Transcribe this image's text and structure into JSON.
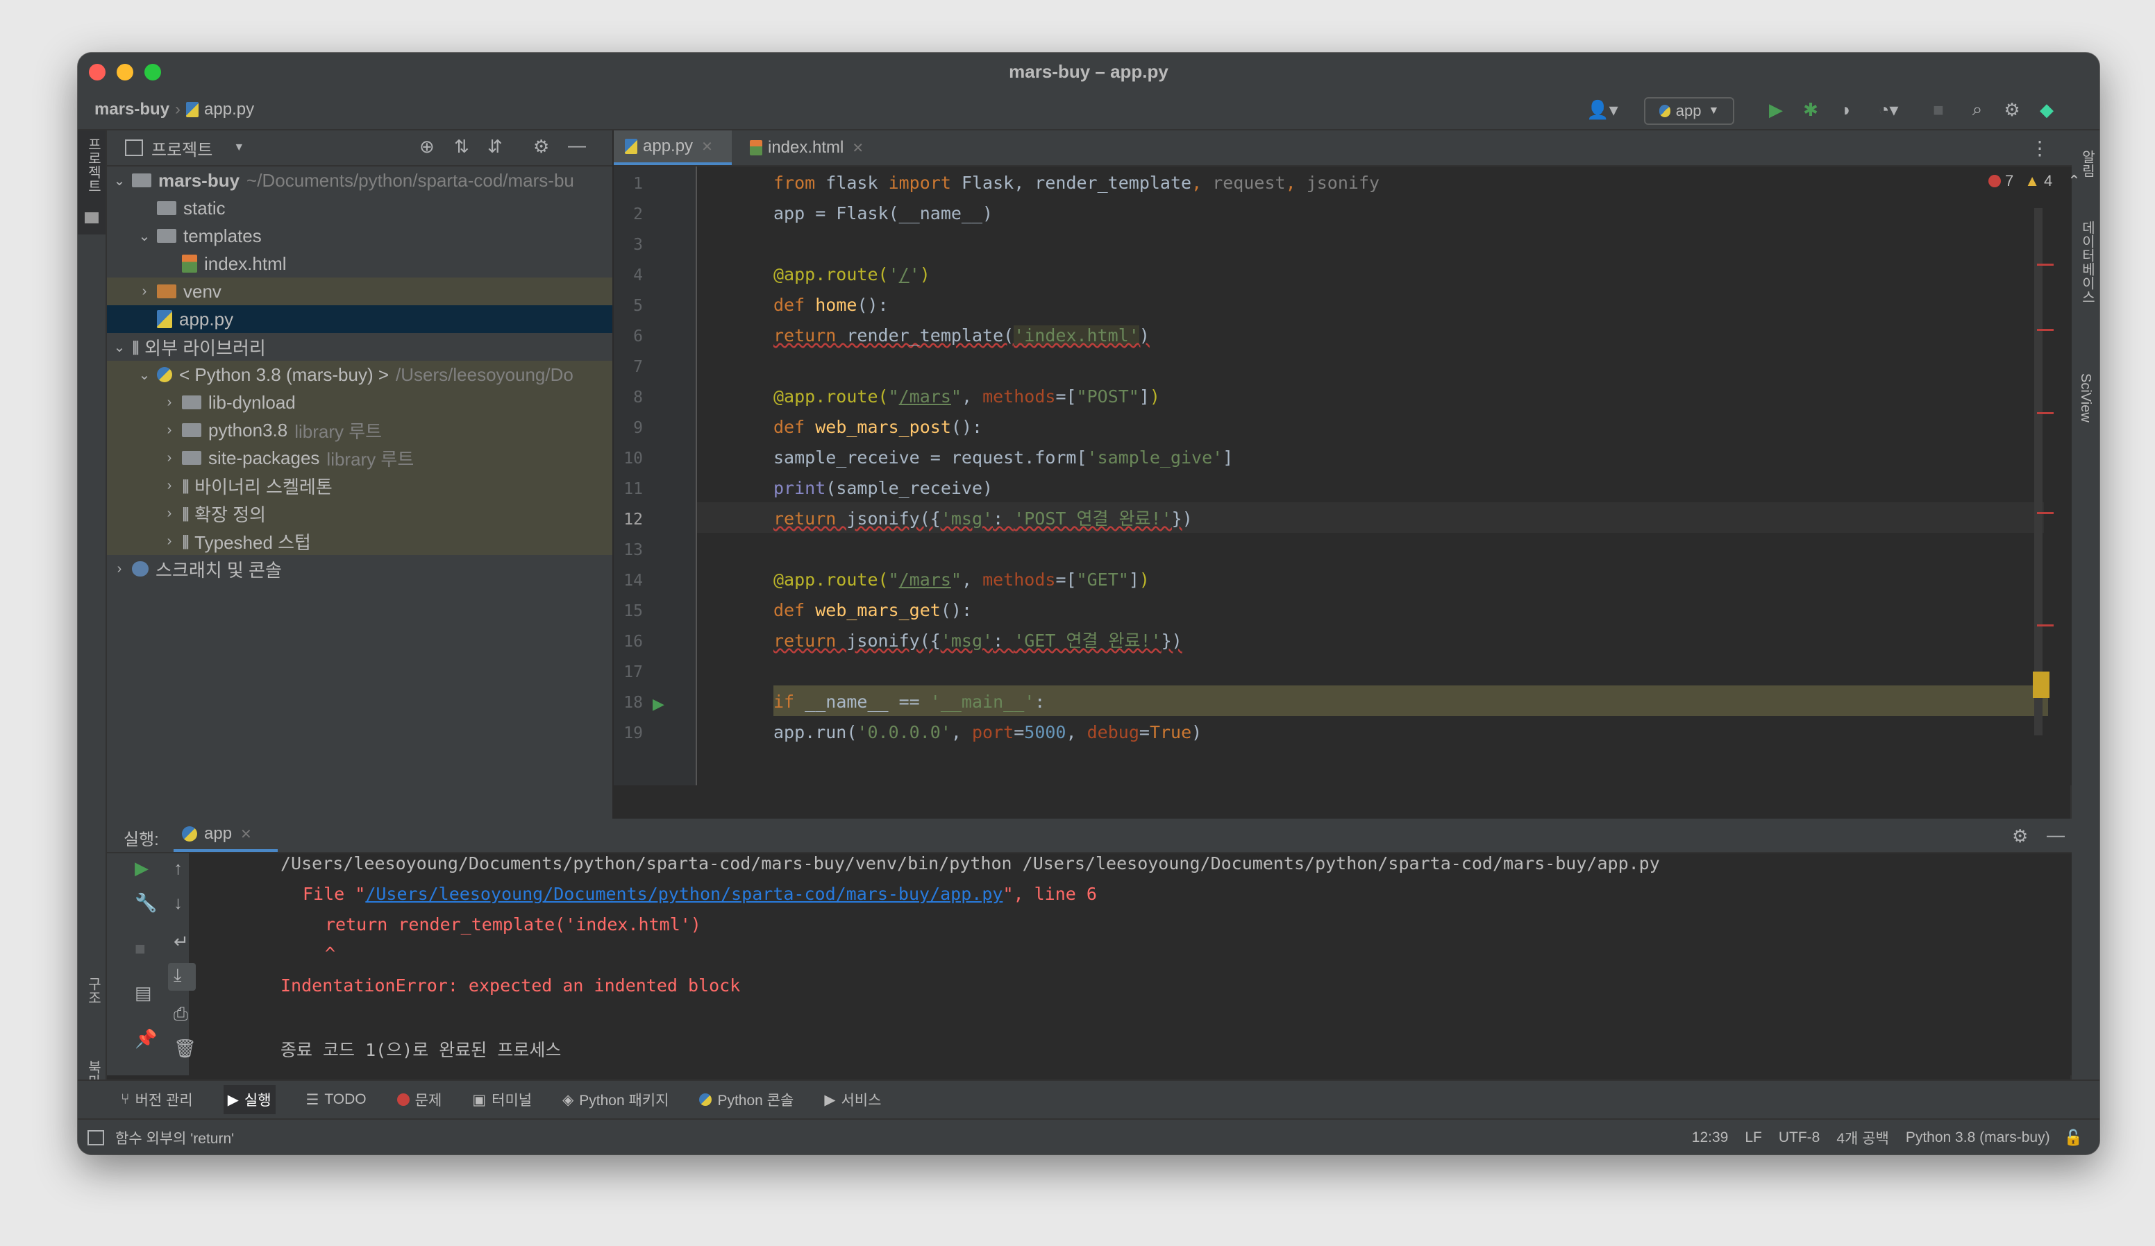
{
  "window": {
    "title": "mars-buy – app.py"
  },
  "breadcrumb": {
    "project": "mars-buy",
    "file": "app.py"
  },
  "toolbar": {
    "run_config": "app"
  },
  "project_panel": {
    "title": "프로젝트",
    "tree": [
      {
        "label": "mars-buy",
        "hint": "~/Documents/python/sparta-cod/mars-bu"
      },
      {
        "label": "static"
      },
      {
        "label": "templates"
      },
      {
        "label": "index.html"
      },
      {
        "label": "venv"
      },
      {
        "label": "app.py"
      },
      {
        "label": "외부 라이브러리"
      },
      {
        "label": "< Python 3.8 (mars-buy) >",
        "hint": "/Users/leesoyoung/Do"
      },
      {
        "label": "lib-dynload"
      },
      {
        "label": "python3.8",
        "hint": "library 루트"
      },
      {
        "label": "site-packages",
        "hint": "library 루트"
      },
      {
        "label": "바이너리 스켈레톤"
      },
      {
        "label": "확장 정의"
      },
      {
        "label": "Typeshed 스텁"
      },
      {
        "label": "스크래치 및 콘솔"
      }
    ]
  },
  "left_strip": {
    "project": "프로젝트",
    "structure": "구조",
    "bookmarks": "북마크"
  },
  "right_strip": {
    "notifications": "알림",
    "database": "데이터베이스",
    "sciview": "SciView"
  },
  "editor": {
    "tabs": [
      {
        "label": "app.py"
      },
      {
        "label": "index.html"
      }
    ],
    "errors": "7",
    "warnings": "4",
    "line_numbers": [
      "1",
      "2",
      "3",
      "4",
      "5",
      "6",
      "7",
      "8",
      "9",
      "10",
      "11",
      "12",
      "13",
      "14",
      "15",
      "16",
      "17",
      "18",
      "19"
    ]
  },
  "run_panel": {
    "label": "실행:",
    "tab": "app",
    "output": {
      "cmd": "/Users/leesoyoung/Documents/python/sparta-cod/mars-buy/venv/bin/python /Users/leesoyoung/Documents/python/sparta-cod/mars-buy/app.py",
      "file_prefix": "File \"",
      "file_link": "/Users/leesoyoung/Documents/python/sparta-cod/mars-buy/app.py",
      "file_suffix": "\", line 6",
      "code": "return render_template('index.html')",
      "caret": "^",
      "error": "IndentationError: expected an indented block",
      "exit": "종료 코드 1(으)로 완료된 프로세스"
    }
  },
  "bottom_tabs": [
    "버전 관리",
    "실행",
    "TODO",
    "문제",
    "터미널",
    "Python 패키지",
    "Python 콘솔",
    "서비스"
  ],
  "status": {
    "message": "함수 외부의 'return'",
    "position": "12:39",
    "line_sep": "LF",
    "encoding": "UTF-8",
    "indent": "4개 공백",
    "interpreter": "Python 3.8 (mars-buy)"
  },
  "colors": {
    "accent": "#4a88c7",
    "run_green": "#499c54",
    "error_red": "#ff6b68",
    "link": "#287bde"
  }
}
